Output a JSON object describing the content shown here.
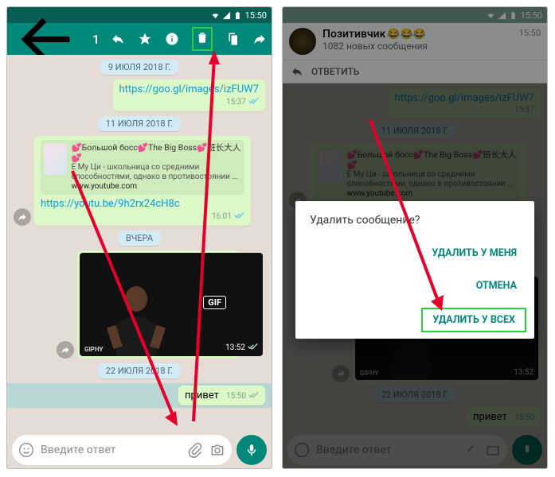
{
  "status": {
    "time": "15:50"
  },
  "toolbar": {
    "count": "1"
  },
  "left": {
    "date1": "9 ИЮЛЯ 2018 Г.",
    "link1": "https://goo.gl/images/izFUW7",
    "link1_time": "15:37",
    "date2": "11 ИЮЛЯ 2018 Г.",
    "preview_title": "💕Большой босс💕The Big Boss💕班长大人💕",
    "preview_desc": "Е Му Ци - школьница со средними способностями, однако в противостоянии ...",
    "preview_site": "www.youtube.com",
    "link2": "https://youtu.be/9h2rx24cH8c",
    "link2_time": "16:01",
    "date3": "ВЧЕРА",
    "gif_label": "GIF",
    "gif_source": "GIPHY",
    "gif_time": "13:52",
    "date4": "22 ИЮЛЯ 2018 Г.",
    "msg_selected": "привет",
    "msg_selected_time": "15:50",
    "input_placeholder": "Введите ответ"
  },
  "right": {
    "notif_title": "Позитивчик",
    "notif_sub": "1082 новых сообщения",
    "notif_time": "15:50",
    "reply_label": "ОТВЕТИТЬ",
    "dialog": {
      "title": "Удалить сообщение?",
      "delete_me": "УДАЛИТЬ У МЕНЯ",
      "cancel": "ОТМЕНА",
      "delete_all": "УДАЛИТЬ У ВСЕХ"
    }
  }
}
